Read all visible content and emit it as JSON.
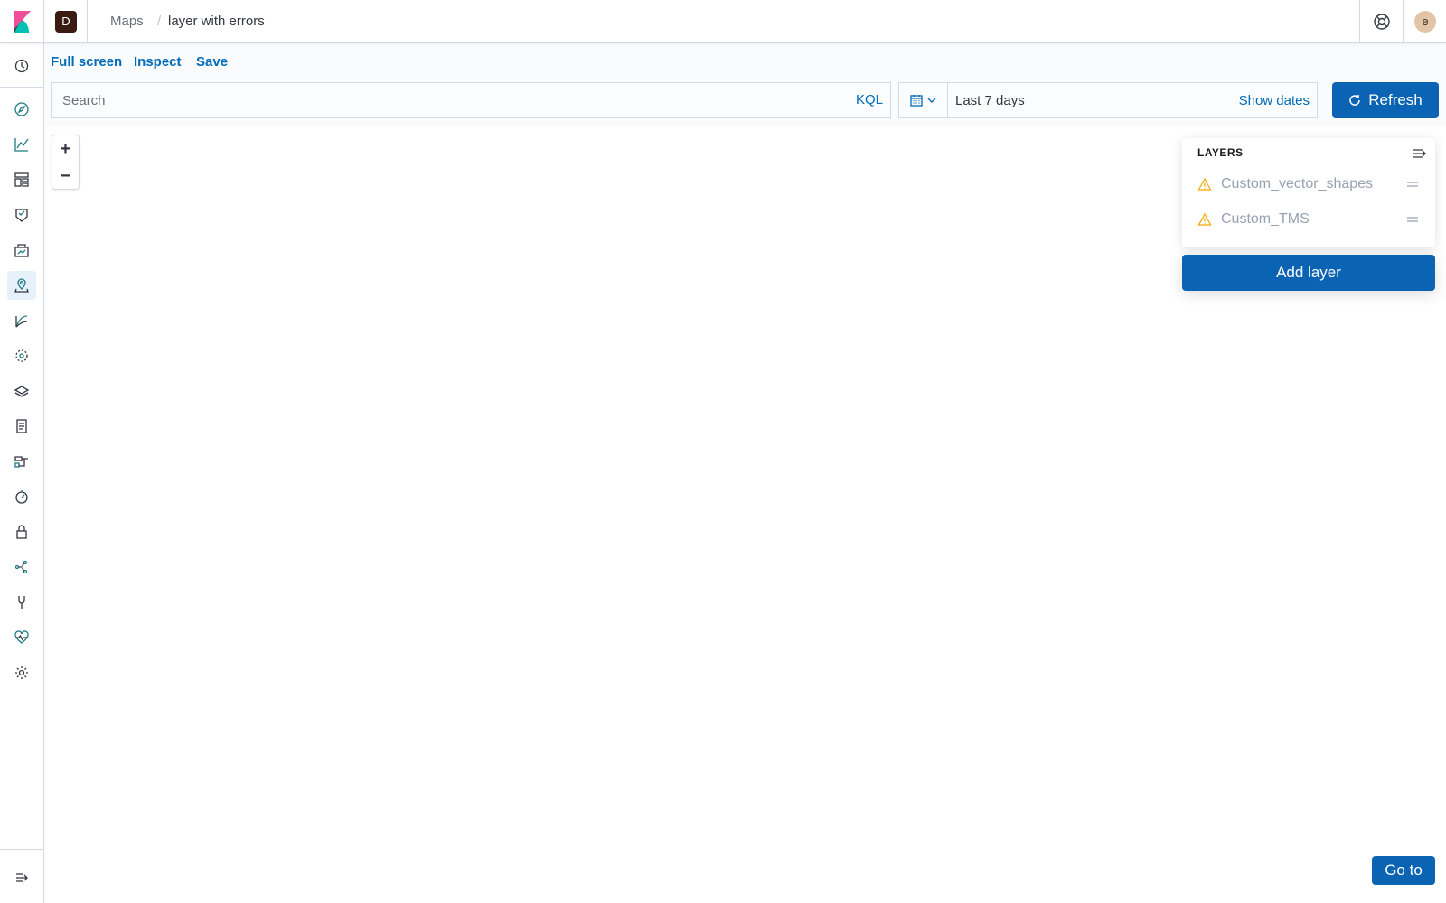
{
  "header": {
    "space_initial": "D",
    "breadcrumbs": [
      "Maps",
      "layer with errors"
    ],
    "separator": "/",
    "user_initial": "e"
  },
  "sidenav": {
    "items": [
      {
        "name": "recently-viewed",
        "icon": "clock-icon"
      },
      {
        "name": "discover",
        "icon": "compass-icon"
      },
      {
        "name": "visualize",
        "icon": "chart-icon"
      },
      {
        "name": "dashboard",
        "icon": "dashboard-icon"
      },
      {
        "name": "canvas",
        "icon": "canvas-icon"
      },
      {
        "name": "ml",
        "icon": "ml-icon"
      },
      {
        "name": "maps",
        "icon": "map-pin-icon",
        "active": true
      },
      {
        "name": "graph",
        "icon": "graph-icon"
      },
      {
        "name": "infrastructure",
        "icon": "infrastructure-icon"
      },
      {
        "name": "logs",
        "icon": "logs-icon"
      },
      {
        "name": "apm",
        "icon": "apm-icon"
      },
      {
        "name": "uptime",
        "icon": "uptime-icon"
      },
      {
        "name": "siem",
        "icon": "security-icon"
      },
      {
        "name": "dev-tools",
        "icon": "dev-tools-icon"
      },
      {
        "name": "index-management",
        "icon": "wrench-icon"
      },
      {
        "name": "monitoring",
        "icon": "heartbeat-icon"
      },
      {
        "name": "management",
        "icon": "gear-icon"
      }
    ]
  },
  "topmenu": {
    "links": [
      "Full screen",
      "Inspect",
      "Save"
    ],
    "search_placeholder": "Search",
    "kql_label": "KQL",
    "date_range": "Last 7 days",
    "show_dates": "Show dates",
    "refresh_label": "Refresh"
  },
  "map": {
    "zoom_in": "+",
    "zoom_out": "−",
    "layers_title": "LAYERS",
    "layers": [
      {
        "name": "Custom_vector_shapes",
        "status": "warning"
      },
      {
        "name": "Custom_TMS",
        "status": "warning"
      }
    ],
    "add_layer_label": "Add layer",
    "goto_label": "Go to"
  },
  "colors": {
    "accent": "#006bb8",
    "primary_button": "#0b64b3",
    "warning": "#f5a700",
    "nav_icon": "#1d7b86"
  }
}
